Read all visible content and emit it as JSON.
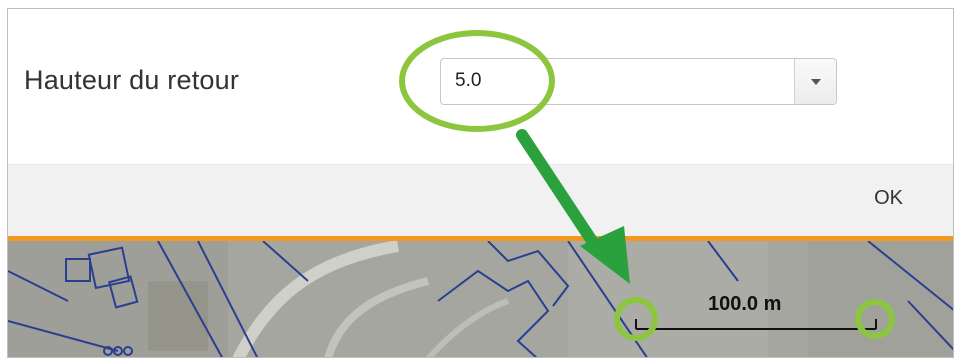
{
  "dialog": {
    "field_label": "Hauteur du retour",
    "select_value": "5.0",
    "ok_label": "OK"
  },
  "map": {
    "scale_label": "100.0 m"
  },
  "colors": {
    "accent": "#f29a1f",
    "highlight": "#8cc63f",
    "arrow": "#2aa13c",
    "map_lines": "#2b3f8f"
  },
  "icons": [
    "chevron-down-icon",
    "arrow-icon"
  ]
}
